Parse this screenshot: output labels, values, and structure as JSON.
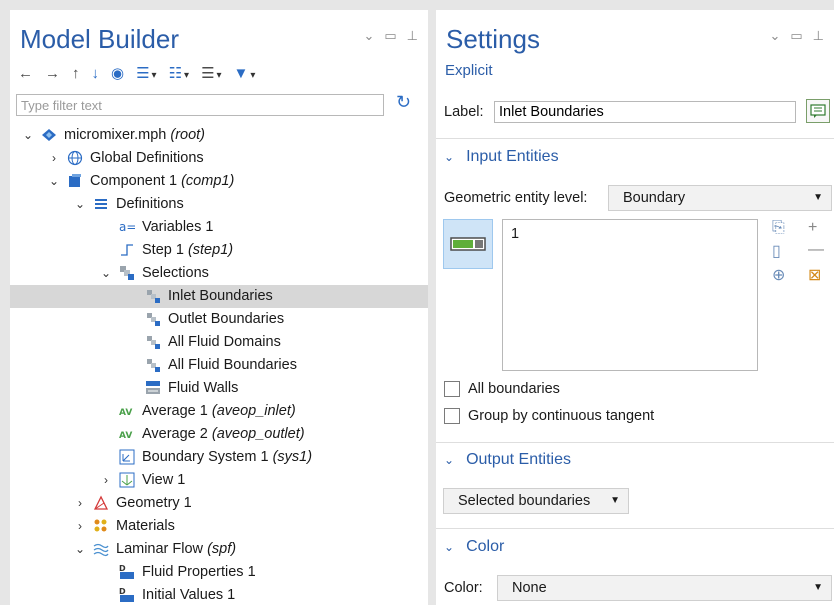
{
  "model_builder": {
    "title": "Model Builder",
    "filter_placeholder": "Type filter text",
    "tree": [
      {
        "level": 0,
        "chevron": "expanded",
        "icon": "root-diamond-icon",
        "label": "micromixer.mph",
        "tag": "(root)"
      },
      {
        "level": 1,
        "chevron": "collapsed",
        "icon": "globe-icon",
        "label": "Global Definitions",
        "tag": ""
      },
      {
        "level": 1,
        "chevron": "expanded",
        "icon": "component-cube-icon",
        "label": "Component 1",
        "tag": "(comp1)"
      },
      {
        "level": 2,
        "chevron": "expanded",
        "icon": "definitions-list-icon",
        "label": "Definitions",
        "tag": ""
      },
      {
        "level": 3,
        "chevron": "none",
        "icon": "variables-icon",
        "label": "Variables 1",
        "tag": ""
      },
      {
        "level": 3,
        "chevron": "none",
        "icon": "step-function-icon",
        "label": "Step 1",
        "tag": "(step1)"
      },
      {
        "level": 3,
        "chevron": "expanded",
        "icon": "selections-icon",
        "label": "Selections",
        "tag": ""
      },
      {
        "level": 4,
        "chevron": "none",
        "icon": "selection-icon",
        "label": "Inlet Boundaries",
        "tag": "",
        "selected": true
      },
      {
        "level": 4,
        "chevron": "none",
        "icon": "selection-icon",
        "label": "Outlet Boundaries",
        "tag": ""
      },
      {
        "level": 4,
        "chevron": "none",
        "icon": "selection-icon",
        "label": "All Fluid Domains",
        "tag": ""
      },
      {
        "level": 4,
        "chevron": "none",
        "icon": "selection-icon",
        "label": "All Fluid Boundaries",
        "tag": ""
      },
      {
        "level": 4,
        "chevron": "none",
        "icon": "fluid-walls-icon",
        "label": "Fluid Walls",
        "tag": ""
      },
      {
        "level": 3,
        "chevron": "none",
        "icon": "average-operator-icon",
        "label": "Average 1",
        "tag": "(aveop_inlet)"
      },
      {
        "level": 3,
        "chevron": "none",
        "icon": "average-operator-icon",
        "label": "Average 2",
        "tag": "(aveop_outlet)"
      },
      {
        "level": 3,
        "chevron": "none",
        "icon": "boundary-system-icon",
        "label": "Boundary System 1",
        "tag": "(sys1)"
      },
      {
        "level": 3,
        "chevron": "collapsed",
        "icon": "view-icon",
        "label": "View 1",
        "tag": ""
      },
      {
        "level": 2,
        "chevron": "collapsed",
        "icon": "geometry-icon",
        "label": "Geometry 1",
        "tag": ""
      },
      {
        "level": 2,
        "chevron": "collapsed",
        "icon": "materials-icon",
        "label": "Materials",
        "tag": ""
      },
      {
        "level": 2,
        "chevron": "expanded",
        "icon": "laminar-flow-icon",
        "label": "Laminar Flow",
        "tag": "(spf)"
      },
      {
        "level": 3,
        "chevron": "none",
        "icon": "fluid-properties-icon",
        "label": "Fluid Properties 1",
        "tag": ""
      },
      {
        "level": 3,
        "chevron": "none",
        "icon": "initial-values-icon",
        "label": "Initial Values 1",
        "tag": ""
      }
    ]
  },
  "settings": {
    "title": "Settings",
    "subtitle": "Explicit",
    "label_field": {
      "label": "Label:",
      "value": "Inlet Boundaries"
    },
    "input_entities": {
      "header": "Input Entities",
      "geom_level_label": "Geometric entity level:",
      "geom_level_value": "Boundary",
      "selection_items": [
        "1"
      ]
    },
    "checkboxes": [
      {
        "label": "All boundaries",
        "checked": false
      },
      {
        "label": "Group by continuous tangent",
        "checked": false
      }
    ],
    "output_entities": {
      "header": "Output Entities",
      "value": "Selected boundaries"
    },
    "color": {
      "header": "Color",
      "label": "Color:",
      "value": "None"
    }
  }
}
